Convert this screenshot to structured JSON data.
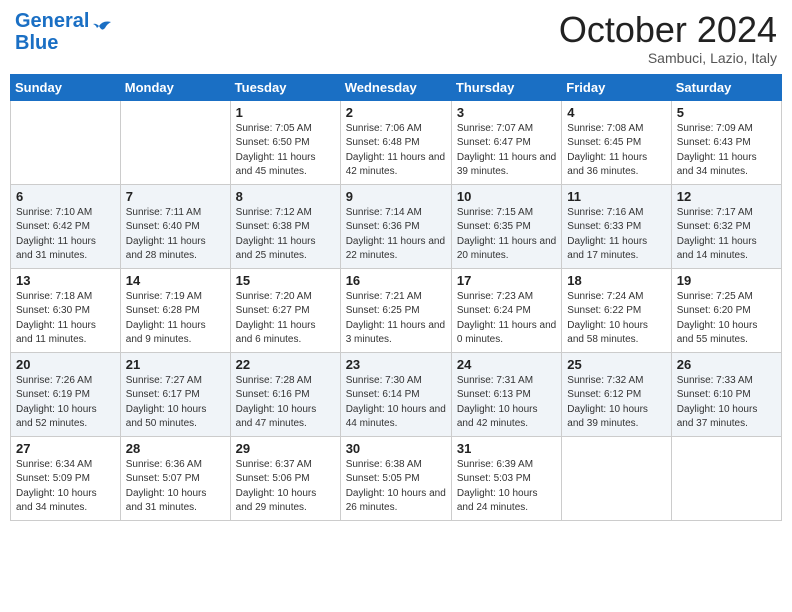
{
  "header": {
    "logo_line1": "General",
    "logo_line2": "Blue",
    "month": "October 2024",
    "location": "Sambuci, Lazio, Italy"
  },
  "days_of_week": [
    "Sunday",
    "Monday",
    "Tuesday",
    "Wednesday",
    "Thursday",
    "Friday",
    "Saturday"
  ],
  "weeks": [
    [
      {
        "day": "",
        "sunrise": "",
        "sunset": "",
        "daylight": ""
      },
      {
        "day": "",
        "sunrise": "",
        "sunset": "",
        "daylight": ""
      },
      {
        "day": "1",
        "sunrise": "Sunrise: 7:05 AM",
        "sunset": "Sunset: 6:50 PM",
        "daylight": "Daylight: 11 hours and 45 minutes."
      },
      {
        "day": "2",
        "sunrise": "Sunrise: 7:06 AM",
        "sunset": "Sunset: 6:48 PM",
        "daylight": "Daylight: 11 hours and 42 minutes."
      },
      {
        "day": "3",
        "sunrise": "Sunrise: 7:07 AM",
        "sunset": "Sunset: 6:47 PM",
        "daylight": "Daylight: 11 hours and 39 minutes."
      },
      {
        "day": "4",
        "sunrise": "Sunrise: 7:08 AM",
        "sunset": "Sunset: 6:45 PM",
        "daylight": "Daylight: 11 hours and 36 minutes."
      },
      {
        "day": "5",
        "sunrise": "Sunrise: 7:09 AM",
        "sunset": "Sunset: 6:43 PM",
        "daylight": "Daylight: 11 hours and 34 minutes."
      }
    ],
    [
      {
        "day": "6",
        "sunrise": "Sunrise: 7:10 AM",
        "sunset": "Sunset: 6:42 PM",
        "daylight": "Daylight: 11 hours and 31 minutes."
      },
      {
        "day": "7",
        "sunrise": "Sunrise: 7:11 AM",
        "sunset": "Sunset: 6:40 PM",
        "daylight": "Daylight: 11 hours and 28 minutes."
      },
      {
        "day": "8",
        "sunrise": "Sunrise: 7:12 AM",
        "sunset": "Sunset: 6:38 PM",
        "daylight": "Daylight: 11 hours and 25 minutes."
      },
      {
        "day": "9",
        "sunrise": "Sunrise: 7:14 AM",
        "sunset": "Sunset: 6:36 PM",
        "daylight": "Daylight: 11 hours and 22 minutes."
      },
      {
        "day": "10",
        "sunrise": "Sunrise: 7:15 AM",
        "sunset": "Sunset: 6:35 PM",
        "daylight": "Daylight: 11 hours and 20 minutes."
      },
      {
        "day": "11",
        "sunrise": "Sunrise: 7:16 AM",
        "sunset": "Sunset: 6:33 PM",
        "daylight": "Daylight: 11 hours and 17 minutes."
      },
      {
        "day": "12",
        "sunrise": "Sunrise: 7:17 AM",
        "sunset": "Sunset: 6:32 PM",
        "daylight": "Daylight: 11 hours and 14 minutes."
      }
    ],
    [
      {
        "day": "13",
        "sunrise": "Sunrise: 7:18 AM",
        "sunset": "Sunset: 6:30 PM",
        "daylight": "Daylight: 11 hours and 11 minutes."
      },
      {
        "day": "14",
        "sunrise": "Sunrise: 7:19 AM",
        "sunset": "Sunset: 6:28 PM",
        "daylight": "Daylight: 11 hours and 9 minutes."
      },
      {
        "day": "15",
        "sunrise": "Sunrise: 7:20 AM",
        "sunset": "Sunset: 6:27 PM",
        "daylight": "Daylight: 11 hours and 6 minutes."
      },
      {
        "day": "16",
        "sunrise": "Sunrise: 7:21 AM",
        "sunset": "Sunset: 6:25 PM",
        "daylight": "Daylight: 11 hours and 3 minutes."
      },
      {
        "day": "17",
        "sunrise": "Sunrise: 7:23 AM",
        "sunset": "Sunset: 6:24 PM",
        "daylight": "Daylight: 11 hours and 0 minutes."
      },
      {
        "day": "18",
        "sunrise": "Sunrise: 7:24 AM",
        "sunset": "Sunset: 6:22 PM",
        "daylight": "Daylight: 10 hours and 58 minutes."
      },
      {
        "day": "19",
        "sunrise": "Sunrise: 7:25 AM",
        "sunset": "Sunset: 6:20 PM",
        "daylight": "Daylight: 10 hours and 55 minutes."
      }
    ],
    [
      {
        "day": "20",
        "sunrise": "Sunrise: 7:26 AM",
        "sunset": "Sunset: 6:19 PM",
        "daylight": "Daylight: 10 hours and 52 minutes."
      },
      {
        "day": "21",
        "sunrise": "Sunrise: 7:27 AM",
        "sunset": "Sunset: 6:17 PM",
        "daylight": "Daylight: 10 hours and 50 minutes."
      },
      {
        "day": "22",
        "sunrise": "Sunrise: 7:28 AM",
        "sunset": "Sunset: 6:16 PM",
        "daylight": "Daylight: 10 hours and 47 minutes."
      },
      {
        "day": "23",
        "sunrise": "Sunrise: 7:30 AM",
        "sunset": "Sunset: 6:14 PM",
        "daylight": "Daylight: 10 hours and 44 minutes."
      },
      {
        "day": "24",
        "sunrise": "Sunrise: 7:31 AM",
        "sunset": "Sunset: 6:13 PM",
        "daylight": "Daylight: 10 hours and 42 minutes."
      },
      {
        "day": "25",
        "sunrise": "Sunrise: 7:32 AM",
        "sunset": "Sunset: 6:12 PM",
        "daylight": "Daylight: 10 hours and 39 minutes."
      },
      {
        "day": "26",
        "sunrise": "Sunrise: 7:33 AM",
        "sunset": "Sunset: 6:10 PM",
        "daylight": "Daylight: 10 hours and 37 minutes."
      }
    ],
    [
      {
        "day": "27",
        "sunrise": "Sunrise: 6:34 AM",
        "sunset": "Sunset: 5:09 PM",
        "daylight": "Daylight: 10 hours and 34 minutes."
      },
      {
        "day": "28",
        "sunrise": "Sunrise: 6:36 AM",
        "sunset": "Sunset: 5:07 PM",
        "daylight": "Daylight: 10 hours and 31 minutes."
      },
      {
        "day": "29",
        "sunrise": "Sunrise: 6:37 AM",
        "sunset": "Sunset: 5:06 PM",
        "daylight": "Daylight: 10 hours and 29 minutes."
      },
      {
        "day": "30",
        "sunrise": "Sunrise: 6:38 AM",
        "sunset": "Sunset: 5:05 PM",
        "daylight": "Daylight: 10 hours and 26 minutes."
      },
      {
        "day": "31",
        "sunrise": "Sunrise: 6:39 AM",
        "sunset": "Sunset: 5:03 PM",
        "daylight": "Daylight: 10 hours and 24 minutes."
      },
      {
        "day": "",
        "sunrise": "",
        "sunset": "",
        "daylight": ""
      },
      {
        "day": "",
        "sunrise": "",
        "sunset": "",
        "daylight": ""
      }
    ]
  ]
}
